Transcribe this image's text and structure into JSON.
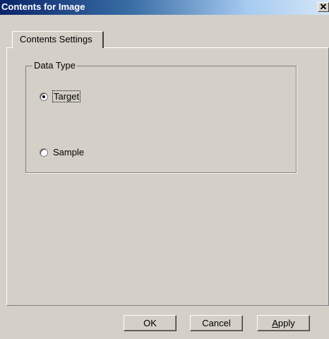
{
  "window": {
    "title": "Contents for Image",
    "close_glyph": "✕"
  },
  "tabs": [
    {
      "label": "Contents Settings"
    }
  ],
  "group": {
    "label": "Data Type",
    "options": [
      {
        "label": "Target",
        "checked": true
      },
      {
        "label": "Sample",
        "checked": false
      }
    ]
  },
  "buttons": {
    "ok": "OK",
    "cancel": "Cancel",
    "apply": "Apply"
  },
  "colors": {
    "face": "#d4d0c8",
    "title_start": "#0a246a",
    "title_end": "#a6caf0"
  }
}
